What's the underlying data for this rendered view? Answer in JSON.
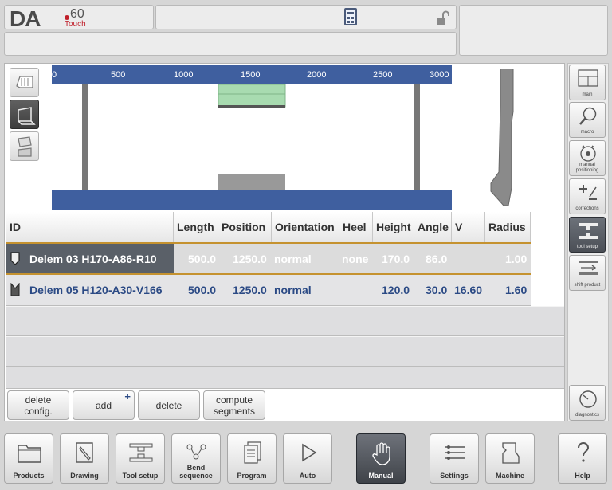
{
  "logo": {
    "brand": "DA",
    "model": "60",
    "edition": "Touch"
  },
  "view_buttons": [
    "front-view-icon",
    "3d-view-icon",
    "side-view-icon"
  ],
  "ruler": {
    "ticks": [
      "0",
      "500",
      "1000",
      "1500",
      "2000",
      "2500",
      "3000"
    ]
  },
  "table": {
    "columns": [
      "ID",
      "Length",
      "Position",
      "Orientation",
      "Heel",
      "Height",
      "Angle",
      "V",
      "Radius"
    ],
    "rows": [
      {
        "icon": "punch-icon",
        "id": "Delem 03 H170-A86-R10",
        "length": "500.0",
        "position": "1250.0",
        "orientation": "normal",
        "heel": "none",
        "height": "170.0",
        "angle": "86.0",
        "v": "",
        "radius": "1.00",
        "selected": true
      },
      {
        "icon": "die-icon",
        "id": "Delem 05 H120-A30-V166",
        "length": "500.0",
        "position": "1250.0",
        "orientation": "normal",
        "heel": "",
        "height": "120.0",
        "angle": "30.0",
        "v": "16.60",
        "radius": "1.60",
        "selected": false
      }
    ]
  },
  "actions": {
    "delete_config": "delete config.",
    "add": "add",
    "add_badge": "+",
    "delete": "delete",
    "compute_segments": "compute segments"
  },
  "side": {
    "main": "main",
    "macro": "macro",
    "manual_positioning": "manual positioning",
    "corrections": "corrections",
    "tool_setup": "tool setup",
    "shift_product": "shift product",
    "diagnostics": "diagnostics"
  },
  "nav": {
    "products": "Products",
    "drawing": "Drawing",
    "tool_setup": "Tool setup",
    "bend_sequence": "Bend sequence",
    "program": "Program",
    "auto": "Auto",
    "manual": "Manual",
    "settings": "Settings",
    "machine": "Machine",
    "help": "Help"
  },
  "colors": {
    "accent": "#c5922f",
    "brand_red": "#c01f2a",
    "ruler_blue": "#3f5f9f",
    "text_blue": "#2b4a85",
    "selected_row": "#5a6068"
  }
}
